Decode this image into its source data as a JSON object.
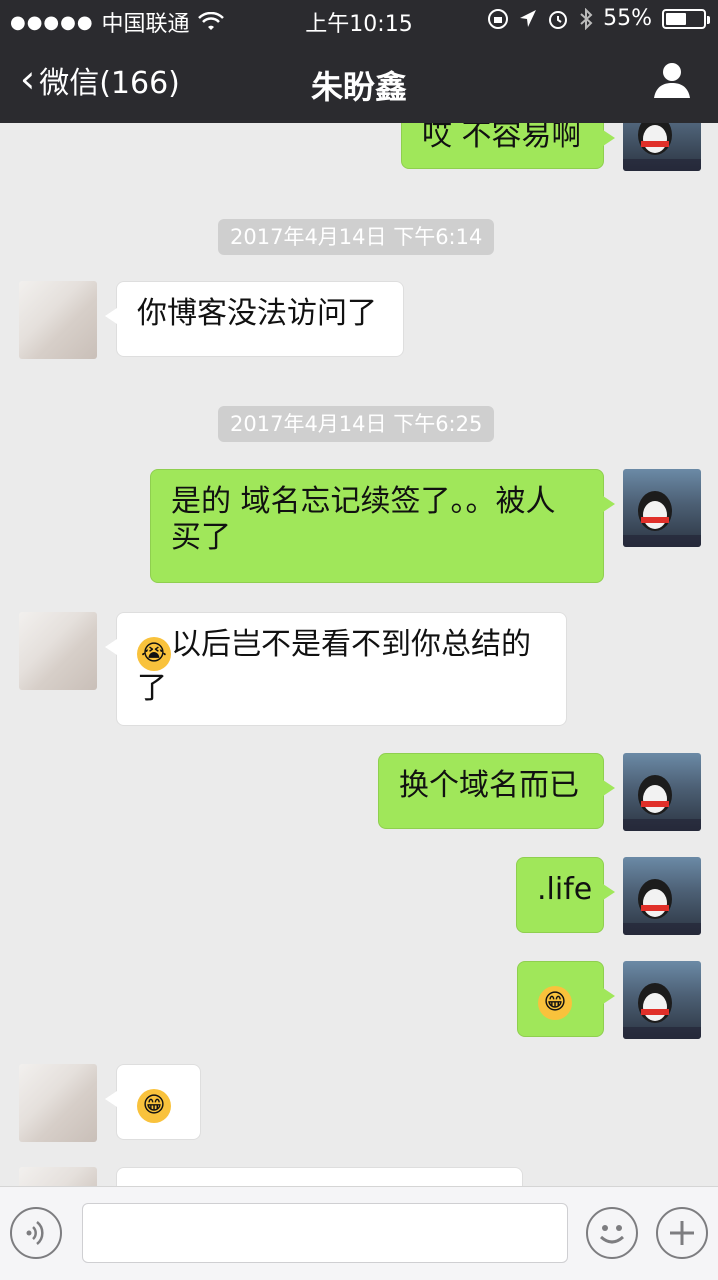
{
  "status_bar": {
    "signal_dots": "●●●●●",
    "carrier": "中国联通",
    "wifi_icon": "wifi-icon",
    "time": "上午10:15",
    "battery_percent": "55%",
    "battery_level": 0.55
  },
  "nav": {
    "back_label": "微信(166)",
    "title": "朱盼鑫",
    "profile_icon": "person-icon"
  },
  "messages": {
    "m1": "哎 不容易啊",
    "ts1": "2017年4月14日 下午6:14",
    "m2": "你博客没法访问了",
    "ts2": "2017年4月14日 下午6:25",
    "m3_line1": "是的 域名忘记续签了。。被人",
    "m3_line2": "买了",
    "m4_line1": "以后岂不是看不到你总结的",
    "m4_line2": "了",
    "m5": "换个域名而已",
    "m6": ".life"
  },
  "emojis": {
    "crying": "😭",
    "grin": "😁"
  },
  "input_bar": {
    "voice_icon": "voice-icon",
    "emoji_icon": "emoji-icon",
    "plus_icon": "plus-icon"
  },
  "colors": {
    "nav_bg": "#2b2b2f",
    "chat_bg": "#ebebeb",
    "my_bubble": "#a0e75a",
    "other_bubble": "#ffffff"
  }
}
